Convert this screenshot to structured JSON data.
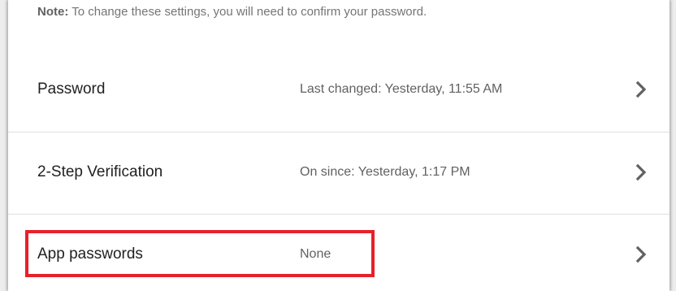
{
  "note": {
    "label": "Note:",
    "text": " To change these settings, you will need to confirm your password."
  },
  "rows": [
    {
      "label": "Password",
      "value": "Last changed: Yesterday, 11:55 AM",
      "icon": "chevron-right-icon"
    },
    {
      "label": "2-Step Verification",
      "value": "On since: Yesterday, 1:17 PM",
      "icon": "chevron-right-icon"
    },
    {
      "label": "App passwords",
      "value": "None",
      "icon": "chevron-right-icon"
    }
  ],
  "colors": {
    "highlight": "#e8202a",
    "chevron": "#616161"
  }
}
